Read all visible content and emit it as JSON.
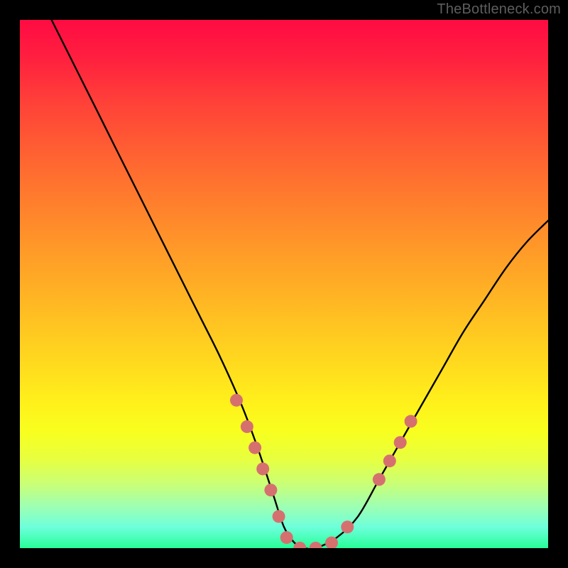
{
  "watermark": "TheBottleneck.com",
  "chart_data": {
    "type": "line",
    "title": "",
    "xlabel": "",
    "ylabel": "",
    "xlim": [
      0,
      100
    ],
    "ylim": [
      0,
      100
    ],
    "grid": false,
    "series": [
      {
        "name": "bottleneck-curve",
        "x": [
          6,
          10,
          14,
          18,
          22,
          26,
          30,
          34,
          38,
          42,
          45,
          48,
          50,
          52,
          54,
          56,
          60,
          64,
          68,
          72,
          76,
          80,
          84,
          88,
          92,
          96,
          100
        ],
        "values": [
          100,
          92,
          84,
          76,
          68,
          60,
          52,
          44,
          36,
          27,
          19,
          10,
          4,
          1,
          0,
          0,
          2,
          6,
          13,
          20,
          27,
          34,
          41,
          47,
          53,
          58,
          62
        ]
      }
    ],
    "markers": [
      {
        "x": 41,
        "y": 28
      },
      {
        "x": 43,
        "y": 23
      },
      {
        "x": 44.5,
        "y": 19
      },
      {
        "x": 46,
        "y": 15
      },
      {
        "x": 47.5,
        "y": 11
      },
      {
        "x": 49,
        "y": 6
      },
      {
        "x": 50.5,
        "y": 2
      },
      {
        "x": 53,
        "y": 0
      },
      {
        "x": 56,
        "y": 0
      },
      {
        "x": 59,
        "y": 1
      },
      {
        "x": 62,
        "y": 4
      },
      {
        "x": 68,
        "y": 13
      },
      {
        "x": 70,
        "y": 16.5
      },
      {
        "x": 72,
        "y": 20
      },
      {
        "x": 74,
        "y": 24
      }
    ],
    "marker_style": {
      "color": "#d6706f",
      "radius_px": 9
    }
  }
}
